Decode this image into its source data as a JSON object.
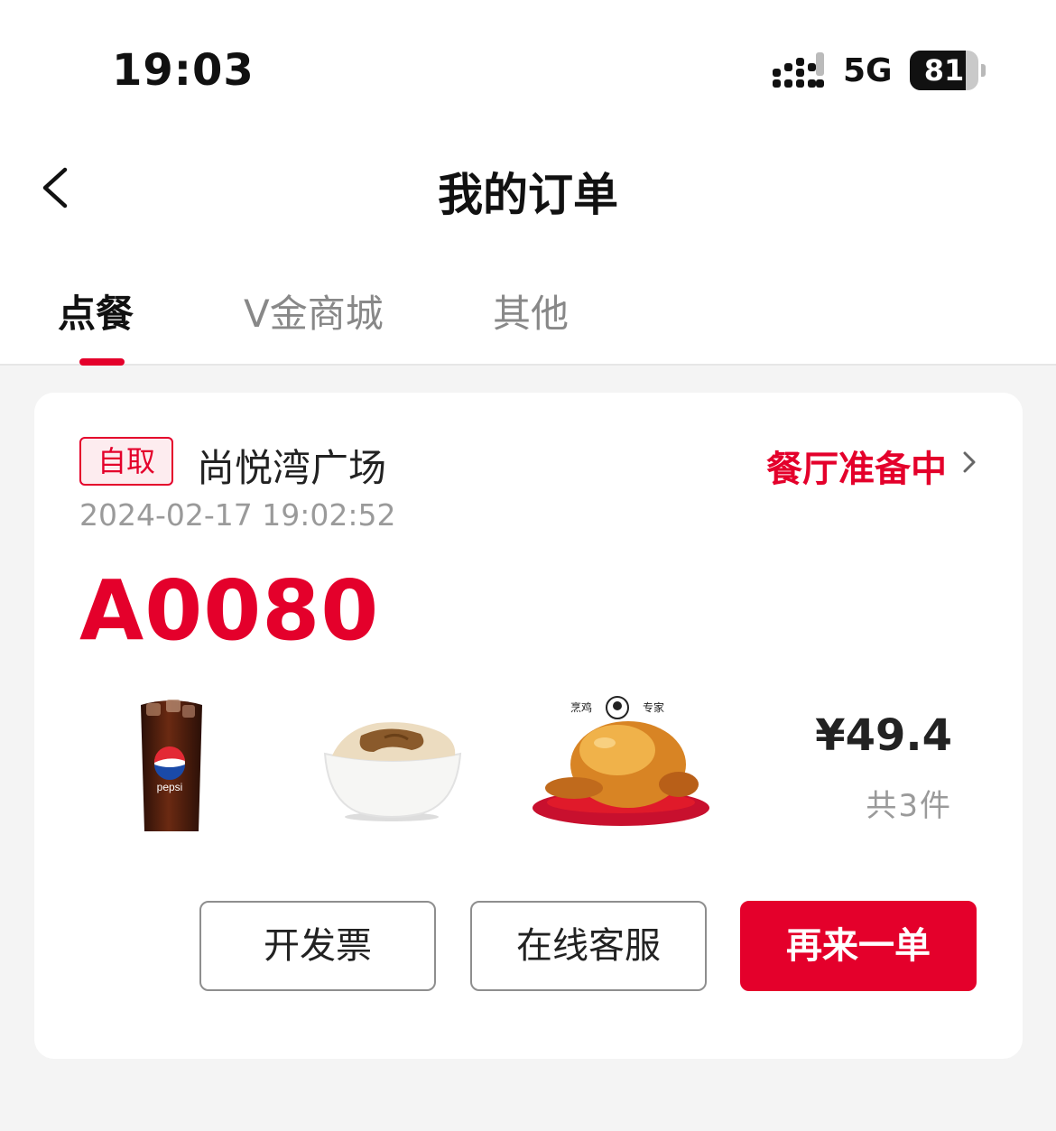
{
  "status_bar": {
    "time": "19:03",
    "network": "5G",
    "battery_level": "81",
    "battery_fraction": 0.81
  },
  "header": {
    "title": "我的订单"
  },
  "tabs": [
    {
      "label": "点餐",
      "active": true
    },
    {
      "label": "V金商城",
      "active": false
    },
    {
      "label": "其他",
      "active": false
    }
  ],
  "order": {
    "type_badge": "自取",
    "store": "尚悦湾广场",
    "status": "餐厅准备中",
    "datetime": "2024-02-17 19:02:52",
    "pickup_code": "A0080",
    "items": [
      {
        "icon": "pepsi-cola-image"
      },
      {
        "icon": "mashed-potato-image"
      },
      {
        "icon": "roast-chicken-image",
        "label_left": "烹鸡",
        "label_right": "专家"
      }
    ],
    "price": "¥49.4",
    "item_count": "共3件",
    "actions": {
      "invoice": "开发票",
      "support": "在线客服",
      "reorder": "再来一单"
    }
  },
  "colors": {
    "accent": "#e4002b",
    "muted": "#9a9a9a",
    "background": "#f4f4f4"
  }
}
